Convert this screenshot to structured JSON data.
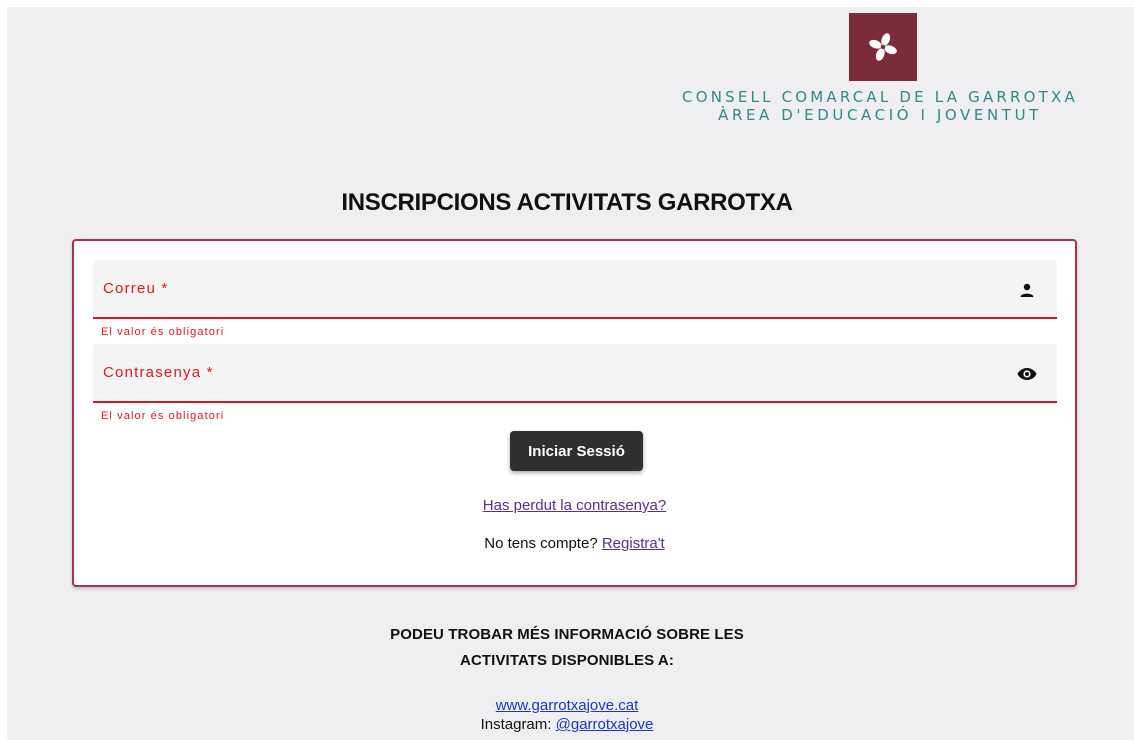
{
  "logo": {
    "org_line1": "CONSELL COMARCAL DE LA GARROTXA",
    "org_line2": "ÀREA D'EDUCACIÓ I JOVENTUT",
    "brand_color": "#7b2b3a",
    "text_color": "#2f8a87"
  },
  "page": {
    "title": "INSCRIPCIONS ACTIVITATS GARROTXA"
  },
  "login": {
    "email": {
      "label": "Correu *",
      "value": "",
      "icon": "person-icon",
      "error": "El valor és obligatori"
    },
    "password": {
      "label": "Contrasenya *",
      "value": "",
      "icon": "eye-icon",
      "error": "El valor és obligatori"
    },
    "submit_label": "Iniciar Sessió",
    "forgot_link": "Has perdut la contrasenya?",
    "no_account_text": "No tens compte?",
    "register_link": "Registra't",
    "accent_color": "#a8344c",
    "error_color": "#e0191b"
  },
  "footer": {
    "info_line1": "PODEU TROBAR MÉS INFORMACIÓ SOBRE LES",
    "info_line2": "ACTIVITATS DISPONIBLES A:",
    "website": "www.garrotxajove.cat",
    "instagram_label": "Instagram:",
    "instagram_handle": "@garrotxajove"
  }
}
